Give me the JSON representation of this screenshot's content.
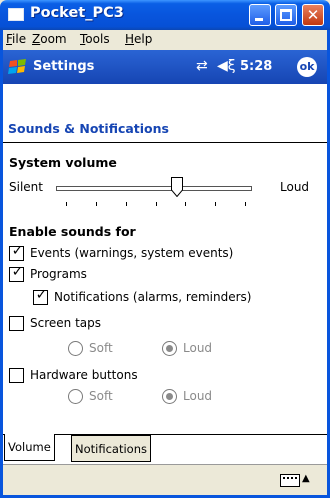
{
  "window": {
    "title": "Pocket_PC3"
  },
  "menu": [
    "File",
    "Zoom",
    "Tools",
    "Help"
  ],
  "navbar": {
    "title": "Settings",
    "time": "5:28",
    "ok_label": "ok"
  },
  "page": {
    "title": "Sounds & Notifications"
  },
  "volume": {
    "heading": "System volume",
    "min_label": "Silent",
    "max_label": "Loud",
    "level_fraction": 0.62
  },
  "sounds": {
    "heading": "Enable sounds for",
    "events": {
      "label": "Events (warnings, system events)",
      "checked": true
    },
    "programs": {
      "label": "Programs",
      "checked": true
    },
    "notifications": {
      "label": "Notifications (alarms, reminders)",
      "checked": true
    },
    "screen_taps": {
      "label": "Screen taps",
      "checked": false,
      "soft": "Soft",
      "loud": "Loud",
      "selected": "Loud"
    },
    "hardware_buttons": {
      "label": "Hardware buttons",
      "checked": false,
      "soft": "Soft",
      "loud": "Loud",
      "selected": "Loud"
    }
  },
  "tabs": [
    {
      "label": "Volume",
      "active": true
    },
    {
      "label": "Notifications",
      "active": false
    }
  ],
  "colors": {
    "titlebar": "#0855dd",
    "navbar": "#1645b3",
    "heading_blue": "#1645b3",
    "close_button": "#c2380f"
  }
}
